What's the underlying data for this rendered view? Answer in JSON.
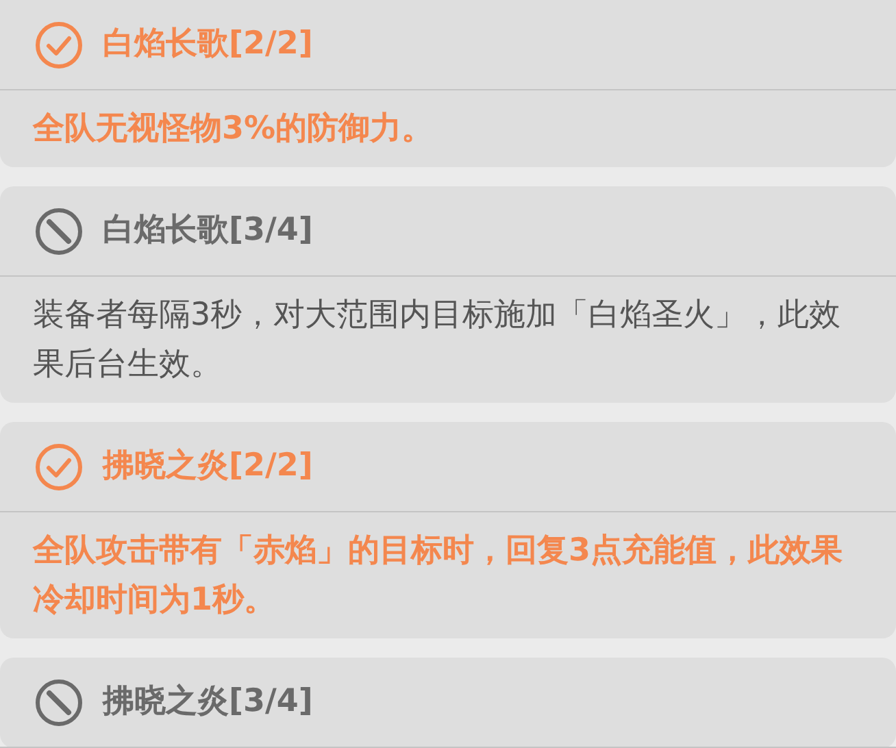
{
  "sets": [
    {
      "title": "白焰长歌[2/2]",
      "active": true,
      "description": "全队无视怪物3%的防御力。"
    },
    {
      "title": "白焰长歌[3/4]",
      "active": false,
      "description": "装备者每隔3秒，对大范围内目标施加「白焰圣火」，此效果后台生效。"
    },
    {
      "title": "拂晓之炎[2/2]",
      "active": true,
      "description": "全队攻击带有「赤焰」的目标时，回复3点充能值，此效果冷却时间为1秒。"
    },
    {
      "title": "拂晓之炎[3/4]",
      "active": false
    }
  ]
}
